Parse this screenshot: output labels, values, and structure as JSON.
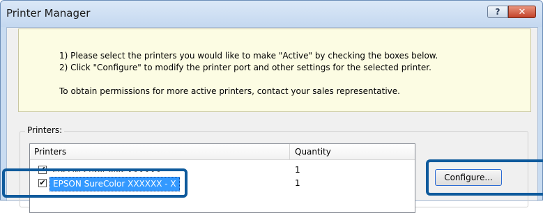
{
  "window": {
    "title": "Printer Manager"
  },
  "titlebar": {
    "help_label": "?",
    "close_label": "✕"
  },
  "info": {
    "line1": "1) Please select the printers you would like to make \"Active\" by checking the boxes below.",
    "line2": "2) Click \"Configure\" to modify the printer port and other settings for the selected printer.",
    "line3": "To obtain permissions for more active printers, contact your sales representative."
  },
  "printers_group": {
    "label": "Printers:"
  },
  "list": {
    "columns": [
      "Printers",
      "Quantity"
    ],
    "rows": [
      {
        "name": "EPSON SureColor XXXXXX",
        "quantity": "1",
        "checked": true,
        "selected": false
      },
      {
        "name": "EPSON SureColor XXXXXX - X",
        "quantity": "1",
        "checked": true,
        "selected": true
      }
    ]
  },
  "buttons": {
    "configure": "Configure..."
  },
  "colors": {
    "accent": "#3399ff",
    "highlight": "#0e5a9c",
    "info_bg": "#fcfce3"
  }
}
